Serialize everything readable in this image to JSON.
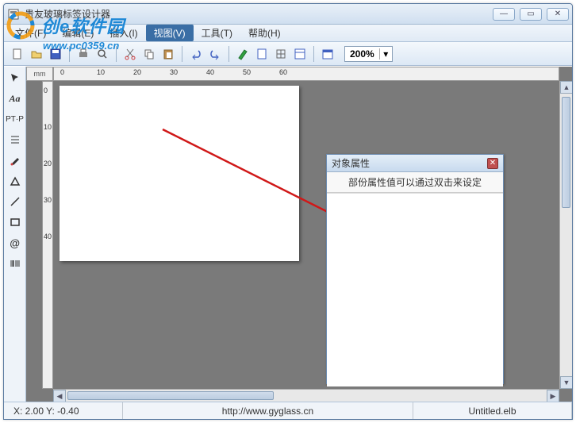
{
  "window": {
    "title": "贵友玻璃标签设计器"
  },
  "menu": {
    "file": "文件(F)",
    "edit": "编辑(E)",
    "insert": "插入(I)",
    "view": "视图(V)",
    "tools": "工具(T)",
    "help": "帮助(H)"
  },
  "toolbar": {
    "zoom": "200%"
  },
  "ruler": {
    "unit": "mm",
    "h_ticks": [
      "0",
      "10",
      "20",
      "30",
      "40",
      "50",
      "60"
    ],
    "v_ticks": [
      "0",
      "10",
      "20",
      "30",
      "40"
    ]
  },
  "properties": {
    "title": "对象属性",
    "hint": "部份属性值可以通过双击来设定"
  },
  "status": {
    "coords": "X: 2.00  Y: -0.40",
    "url": "http://www.gyglass.cn",
    "filename": "Untitled.elb"
  },
  "watermark": {
    "brand": "创e软件园",
    "url": "www.pc0359.cn"
  }
}
